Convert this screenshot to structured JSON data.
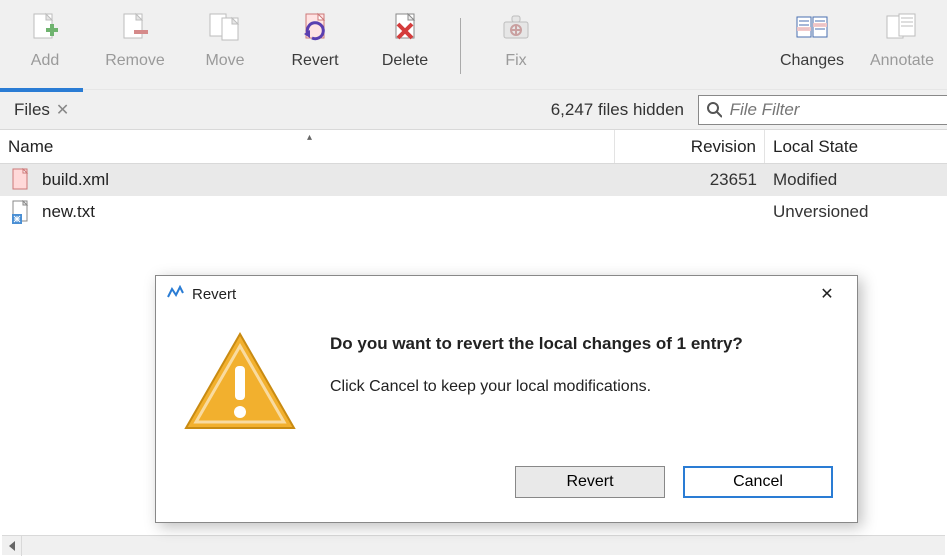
{
  "toolbar": {
    "add": {
      "label": "Add",
      "enabled": false
    },
    "remove": {
      "label": "Remove",
      "enabled": false
    },
    "move": {
      "label": "Move",
      "enabled": false
    },
    "revert": {
      "label": "Revert",
      "enabled": true
    },
    "delete": {
      "label": "Delete",
      "enabled": true
    },
    "fix": {
      "label": "Fix",
      "enabled": false
    },
    "changes": {
      "label": "Changes",
      "enabled": true
    },
    "annotate": {
      "label": "Annotate",
      "enabled": false
    }
  },
  "tabs": {
    "files": {
      "label": "Files",
      "closable": true,
      "active": true
    }
  },
  "filter": {
    "hidden_count": "6,247 files hidden",
    "placeholder": "File Filter"
  },
  "columns": {
    "name": "Name",
    "revision": "Revision",
    "local_state": "Local State"
  },
  "rows": [
    {
      "name": "build.xml",
      "revision": "23651",
      "state": "Modified",
      "selected": true,
      "icon": "file-modified"
    },
    {
      "name": "new.txt",
      "revision": "",
      "state": "Unversioned",
      "selected": false,
      "icon": "file-unversioned"
    }
  ],
  "dialog": {
    "title": "Revert",
    "headline": "Do you want to revert the local changes of 1 entry?",
    "subline": "Click Cancel to keep your local modifications.",
    "confirm": "Revert",
    "cancel": "Cancel"
  }
}
